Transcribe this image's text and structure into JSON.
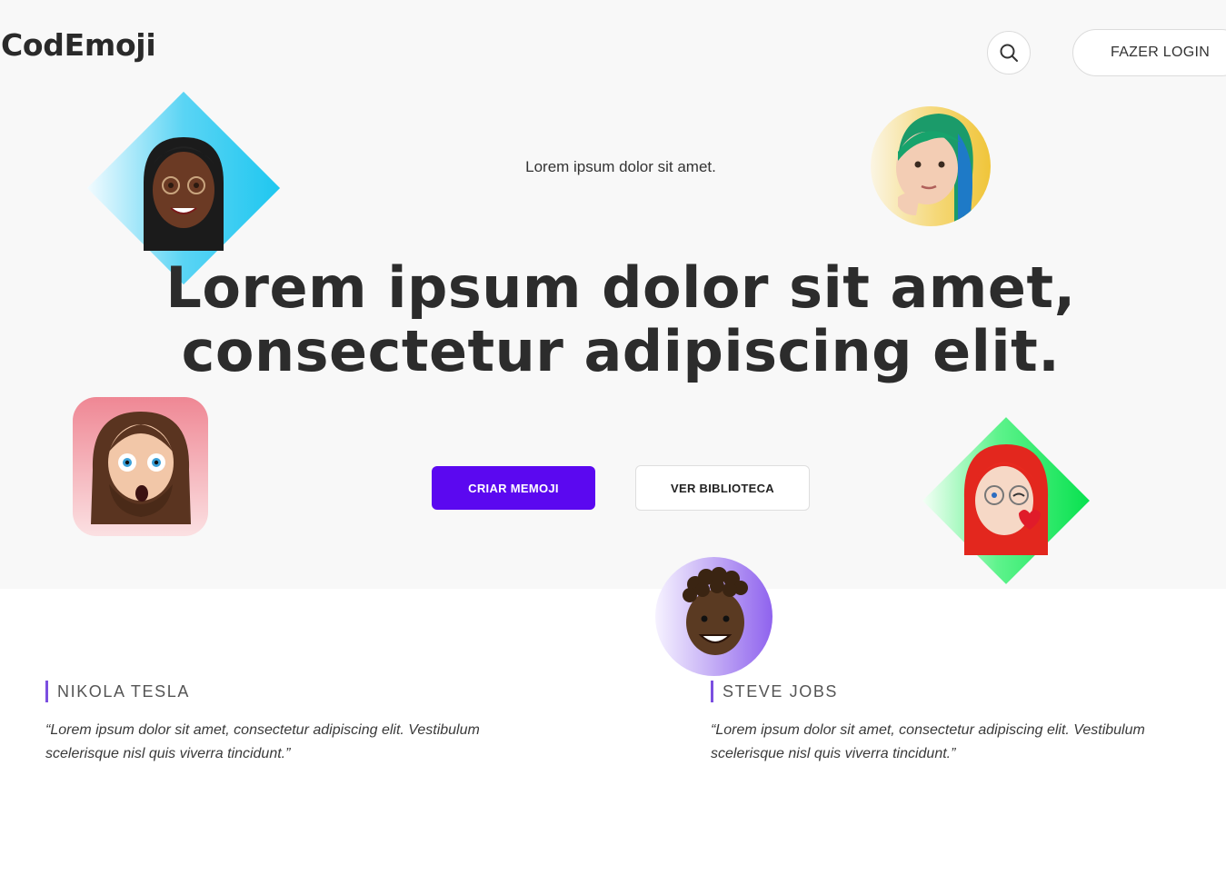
{
  "header": {
    "logo": "CodEmoji",
    "search_icon": "search-icon",
    "login_label": "FAZER LOGIN"
  },
  "hero": {
    "kicker": "Lorem ipsum dolor sit amet.",
    "headline_line1": "Lorem ipsum dolor sit amet,",
    "headline_line2": "consectetur adipiscing elit.",
    "primary_button": "CRIAR MEMOJI",
    "secondary_button": "VER BIBLIOTECA",
    "accent_color": "#5b08f0"
  },
  "testimonials": [
    {
      "name": "NIKOLA TESLA",
      "quote": "“Lorem ipsum dolor sit amet, consectetur adipiscing elit. Vestibulum scelerisque nisl quis viverra tincidunt.”"
    },
    {
      "name": "STEVE JOBS",
      "quote": "“Lorem ipsum dolor sit amet, consectetur adipiscing elit. Vestibulum scelerisque nisl quis viverra tincidunt.”"
    }
  ]
}
